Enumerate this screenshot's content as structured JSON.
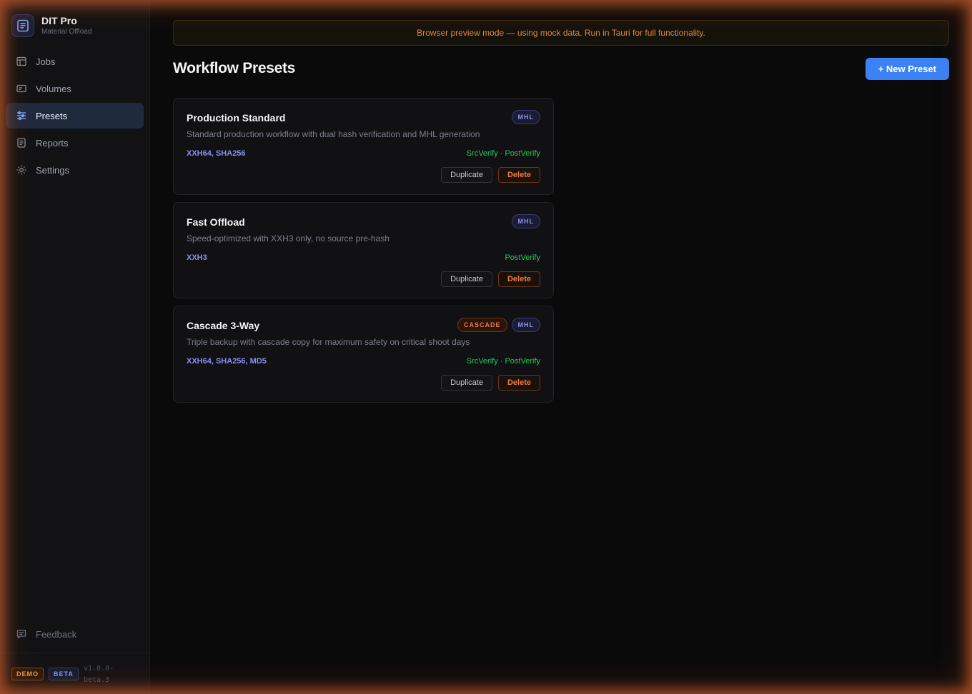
{
  "app": {
    "title": "DIT Pro",
    "subtitle": "Material Offload"
  },
  "sidebar": {
    "items": [
      {
        "label": "Jobs",
        "icon": "calendar-grid-icon",
        "active": false
      },
      {
        "label": "Volumes",
        "icon": "drive-icon",
        "active": false
      },
      {
        "label": "Presets",
        "icon": "sliders-icon",
        "active": true
      },
      {
        "label": "Reports",
        "icon": "document-icon",
        "active": false
      },
      {
        "label": "Settings",
        "icon": "gear-icon",
        "active": false
      }
    ],
    "feedback_label": "Feedback",
    "badges": {
      "demo": "DEMO",
      "beta": "BETA"
    },
    "version": "v1.0.0-beta.3"
  },
  "banner": {
    "text": "Browser preview mode — using mock data. Run in Tauri for full functionality."
  },
  "page": {
    "title": "Workflow Presets",
    "new_button": "+ New Preset"
  },
  "presets": [
    {
      "name": "Production Standard",
      "description": "Standard production workflow with dual hash verification and MHL generation",
      "algorithms": "XXH64, SHA256",
      "verify": "SrcVerify · PostVerify",
      "tags": [
        "MHL"
      ]
    },
    {
      "name": "Fast Offload",
      "description": "Speed-optimized with XXH3 only, no source pre-hash",
      "algorithms": "XXH3",
      "verify": "PostVerify",
      "tags": [
        "MHL"
      ]
    },
    {
      "name": "Cascade 3-Way",
      "description": "Triple backup with cascade copy for maximum safety on critical shoot days",
      "algorithms": "XXH64, SHA256, MD5",
      "verify": "SrcVerify · PostVerify",
      "tags": [
        "CASCADE",
        "MHL"
      ]
    }
  ],
  "card_actions": {
    "duplicate": "Duplicate",
    "delete": "Delete"
  },
  "colors": {
    "accent": "#3b82f6",
    "warning": "#e08a3c",
    "verify_green": "#22c55e",
    "algo_purple": "#8b8ff0"
  }
}
